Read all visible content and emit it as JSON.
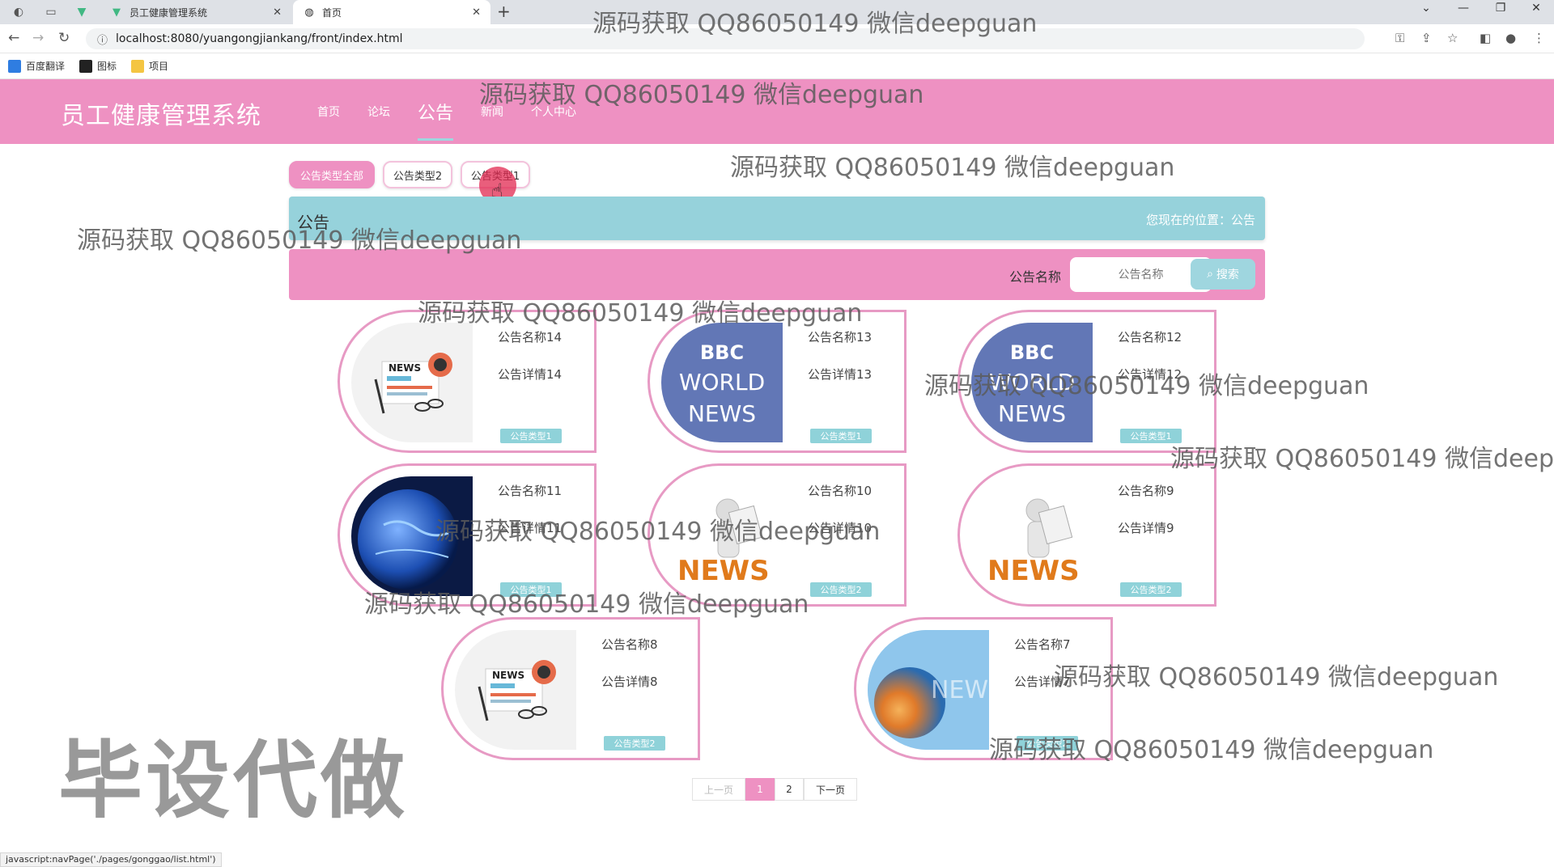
{
  "browser": {
    "tabs": [
      {
        "title": "员工健康管理系统",
        "active": false
      },
      {
        "title": "首页",
        "active": true
      }
    ],
    "url": "localhost:8080/yuangongjiankang/front/index.html",
    "bookmarks": [
      "百度翻译",
      "图标",
      "项目"
    ],
    "status_text": "javascript:navPage('./pages/gonggao/list.html')"
  },
  "header": {
    "site_title": "员工健康管理系统",
    "menu": [
      {
        "label": "首页",
        "active": false
      },
      {
        "label": "论坛",
        "active": false
      },
      {
        "label": "公告",
        "active": true
      },
      {
        "label": "新闻",
        "active": false
      },
      {
        "label": "个人中心",
        "active": false
      }
    ]
  },
  "categories": [
    {
      "label": "公告类型全部",
      "active": true
    },
    {
      "label": "公告类型2",
      "active": false
    },
    {
      "label": "公告类型1",
      "active": false
    }
  ],
  "breadcrumb": {
    "title": "公告",
    "location": "您现在的位置：公告"
  },
  "search": {
    "label": "公告名称",
    "placeholder": "公告名称",
    "button": "搜索"
  },
  "cards": [
    {
      "name": "公告名称14",
      "detail": "公告详情14",
      "type": "公告类型1",
      "image": "news-icon"
    },
    {
      "name": "公告名称13",
      "detail": "公告详情13",
      "type": "公告类型1",
      "image": "bbc-world-news"
    },
    {
      "name": "公告名称12",
      "detail": "公告详情12",
      "type": "公告类型1",
      "image": "bbc-world-news"
    },
    {
      "name": "公告名称11",
      "detail": "公告详情11",
      "type": "公告类型1",
      "image": "globe-news"
    },
    {
      "name": "公告名称10",
      "detail": "公告详情10",
      "type": "公告类型2",
      "image": "man-reading-news"
    },
    {
      "name": "公告名称9",
      "detail": "公告详情9",
      "type": "公告类型2",
      "image": "man-reading-news"
    },
    {
      "name": "公告名称8",
      "detail": "公告详情8",
      "type": "公告类型2",
      "image": "news-icon"
    },
    {
      "name": "公告名称7",
      "detail": "公告详情7",
      "type": "公告类型2",
      "image": "ocean-news"
    }
  ],
  "image_text": {
    "news": "NEWS",
    "bbc": "BBC",
    "world": "WORLD",
    "news_upper": "NEWS"
  },
  "pagination": {
    "prev": "上一页",
    "pages": [
      "1",
      "2"
    ],
    "current": "1",
    "next": "下一页"
  },
  "watermarks": {
    "text": "源码获取 QQ86050149 微信deepguan",
    "big": "毕设代做"
  },
  "colors": {
    "primary_pink": "#ee91c2",
    "accent_teal": "#96d2db",
    "card_border": "#e79ac4"
  }
}
